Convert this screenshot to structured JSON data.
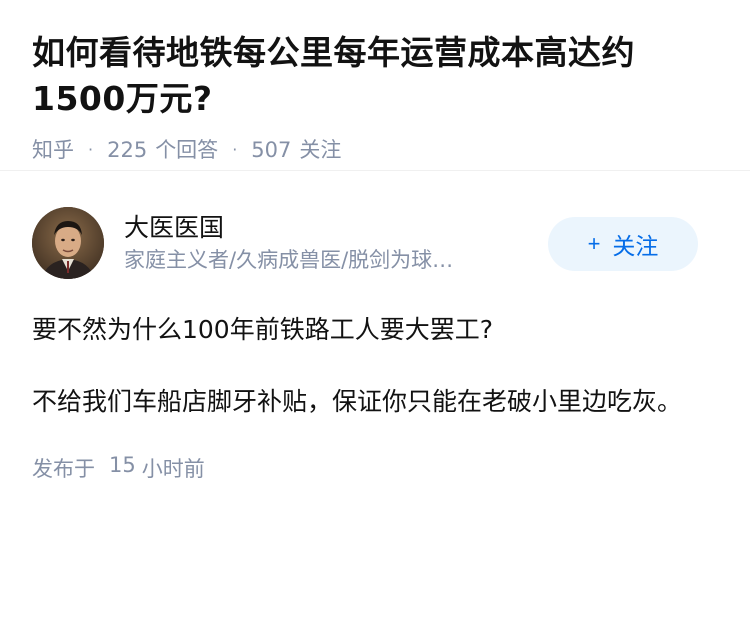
{
  "question": {
    "title": "如何看待地铁每公里每年运营成本高达约1500万元?",
    "source": "知乎",
    "answer_count": "225",
    "answer_label": "个回答",
    "follower_count": "507",
    "follower_label": "关注"
  },
  "answer": {
    "author_name": "大医医国",
    "author_bio": "家庭主义者/久病成兽医/脱剑为球…",
    "follow_label": "关注",
    "follow_icon": "plus-icon",
    "paragraphs": [
      "要不然为什么100年前铁路工人要大罢工?",
      "不给我们车船店脚牙补贴，保证你只能在老破小里边吃灰。"
    ],
    "time_prefix": "发布于",
    "time_value": "15",
    "time_unit": "小时前"
  },
  "colors": {
    "accent": "#056de8",
    "follow_bg": "#ebf5fd",
    "meta_gray": "#8590a6",
    "text": "#121212"
  }
}
